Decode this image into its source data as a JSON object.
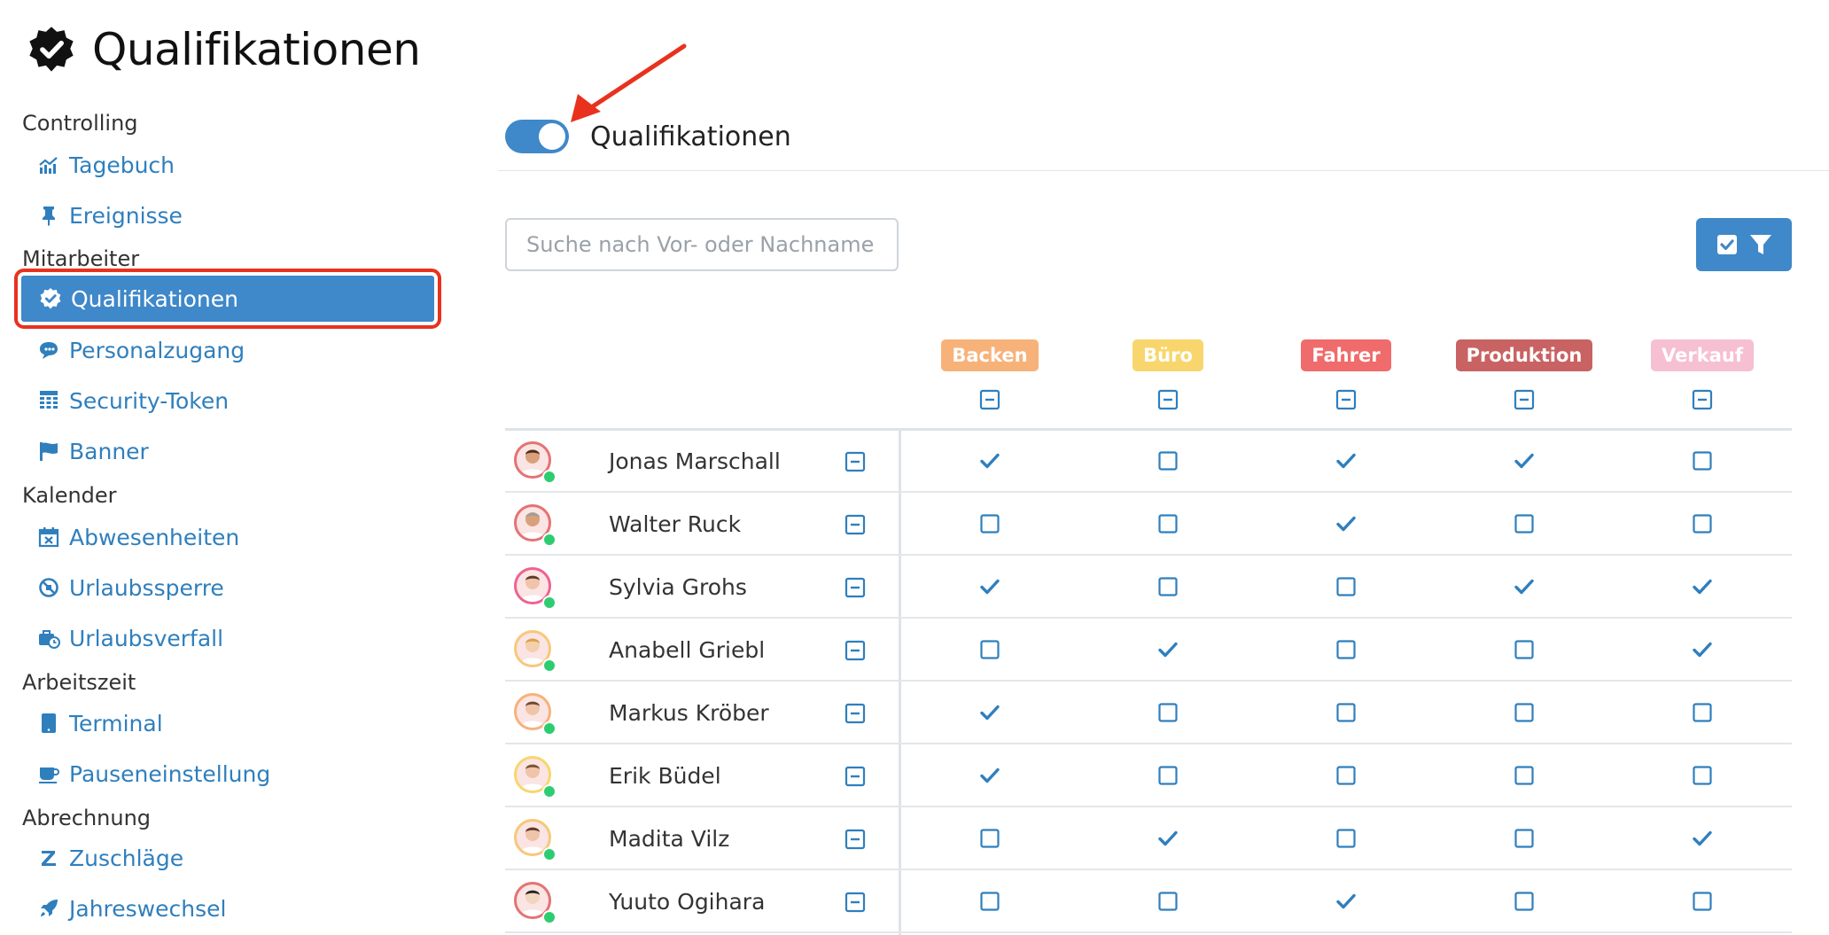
{
  "page": {
    "title": "Qualifikationen"
  },
  "sidebar": {
    "sections": [
      {
        "label": "Controlling",
        "items": [
          {
            "label": "Tagebuch",
            "icon": "chart-line-icon"
          },
          {
            "label": "Ereignisse",
            "icon": "pin-icon"
          }
        ]
      },
      {
        "label": "Mitarbeiter",
        "items": [
          {
            "label": "Qualifikationen",
            "icon": "badge-check-icon",
            "active": true
          },
          {
            "label": "Personalzugang",
            "icon": "user-chat-icon"
          },
          {
            "label": "Security-Token",
            "icon": "keypad-icon"
          },
          {
            "label": "Banner",
            "icon": "flag-icon"
          }
        ]
      },
      {
        "label": "Kalender",
        "items": [
          {
            "label": "Abwesenheiten",
            "icon": "calendar-x-icon"
          },
          {
            "label": "Urlaubssperre",
            "icon": "ban-icon"
          },
          {
            "label": "Urlaubsverfall",
            "icon": "suitcase-clock-icon"
          }
        ]
      },
      {
        "label": "Arbeitszeit",
        "items": [
          {
            "label": "Terminal",
            "icon": "tablet-icon"
          },
          {
            "label": "Pauseneinstellung",
            "icon": "coffee-icon"
          }
        ]
      },
      {
        "label": "Abrechnung",
        "items": [
          {
            "label": "Zuschläge",
            "icon": "z-letter-icon"
          },
          {
            "label": "Jahreswechsel",
            "icon": "rocket-icon"
          }
        ]
      }
    ]
  },
  "main": {
    "toggle_label": "Qualifikationen",
    "toggle_on": true,
    "search_placeholder": "Suche nach Vor- oder Nachname",
    "filter_icon": "check-filter-icon"
  },
  "qualifications": [
    {
      "label": "Backen",
      "bg": "#f7b27a",
      "fg": "#ffffff"
    },
    {
      "label": "Büro",
      "bg": "#f8d66d",
      "fg": "#ffffff"
    },
    {
      "label": "Fahrer",
      "bg": "#f06b6b",
      "fg": "#ffffff"
    },
    {
      "label": "Produktion",
      "bg": "#c96262",
      "fg": "#ffffff"
    },
    {
      "label": "Verkauf",
      "bg": "#f6bfd2",
      "fg": "#ffffff"
    }
  ],
  "employees": [
    {
      "name": "Jonas Marschall",
      "ring": "#e57373",
      "skin": "#d9a07a",
      "hair": "#4a2f20",
      "checks": [
        true,
        false,
        true,
        true,
        false
      ]
    },
    {
      "name": "Walter Ruck",
      "ring": "#e57373",
      "skin": "#d9a07a",
      "hair": "#9e9e9e",
      "checks": [
        false,
        false,
        true,
        false,
        false
      ]
    },
    {
      "name": "Sylvia Grohs",
      "ring": "#f06292",
      "skin": "#f0c4a8",
      "hair": "#5a3a2a",
      "checks": [
        true,
        false,
        false,
        true,
        true
      ]
    },
    {
      "name": "Anabell Griebl",
      "ring": "#f7c87a",
      "skin": "#f3cfae",
      "hair": "#d8a24a",
      "checks": [
        false,
        true,
        false,
        false,
        true
      ]
    },
    {
      "name": "Markus Kröber",
      "ring": "#f7b27a",
      "skin": "#f0c4a8",
      "hair": "#6b4a32",
      "checks": [
        true,
        false,
        false,
        false,
        false
      ]
    },
    {
      "name": "Erik Büdel",
      "ring": "#f8d66d",
      "skin": "#f0c4a8",
      "hair": "#7a5234",
      "checks": [
        true,
        false,
        false,
        false,
        false
      ]
    },
    {
      "name": "Madita Vilz",
      "ring": "#f7c87a",
      "skin": "#f0c4a8",
      "hair": "#5a3a2a",
      "checks": [
        false,
        true,
        false,
        false,
        true
      ]
    },
    {
      "name": "Yuuto Ogihara",
      "ring": "#e57373",
      "skin": "#f0d6bd",
      "hair": "#222222",
      "checks": [
        false,
        false,
        true,
        false,
        false
      ]
    }
  ],
  "colors": {
    "accent": "#3f88c9",
    "link": "#2f7fbd",
    "highlight_border": "#e8321e",
    "status_online": "#2ecc71"
  }
}
